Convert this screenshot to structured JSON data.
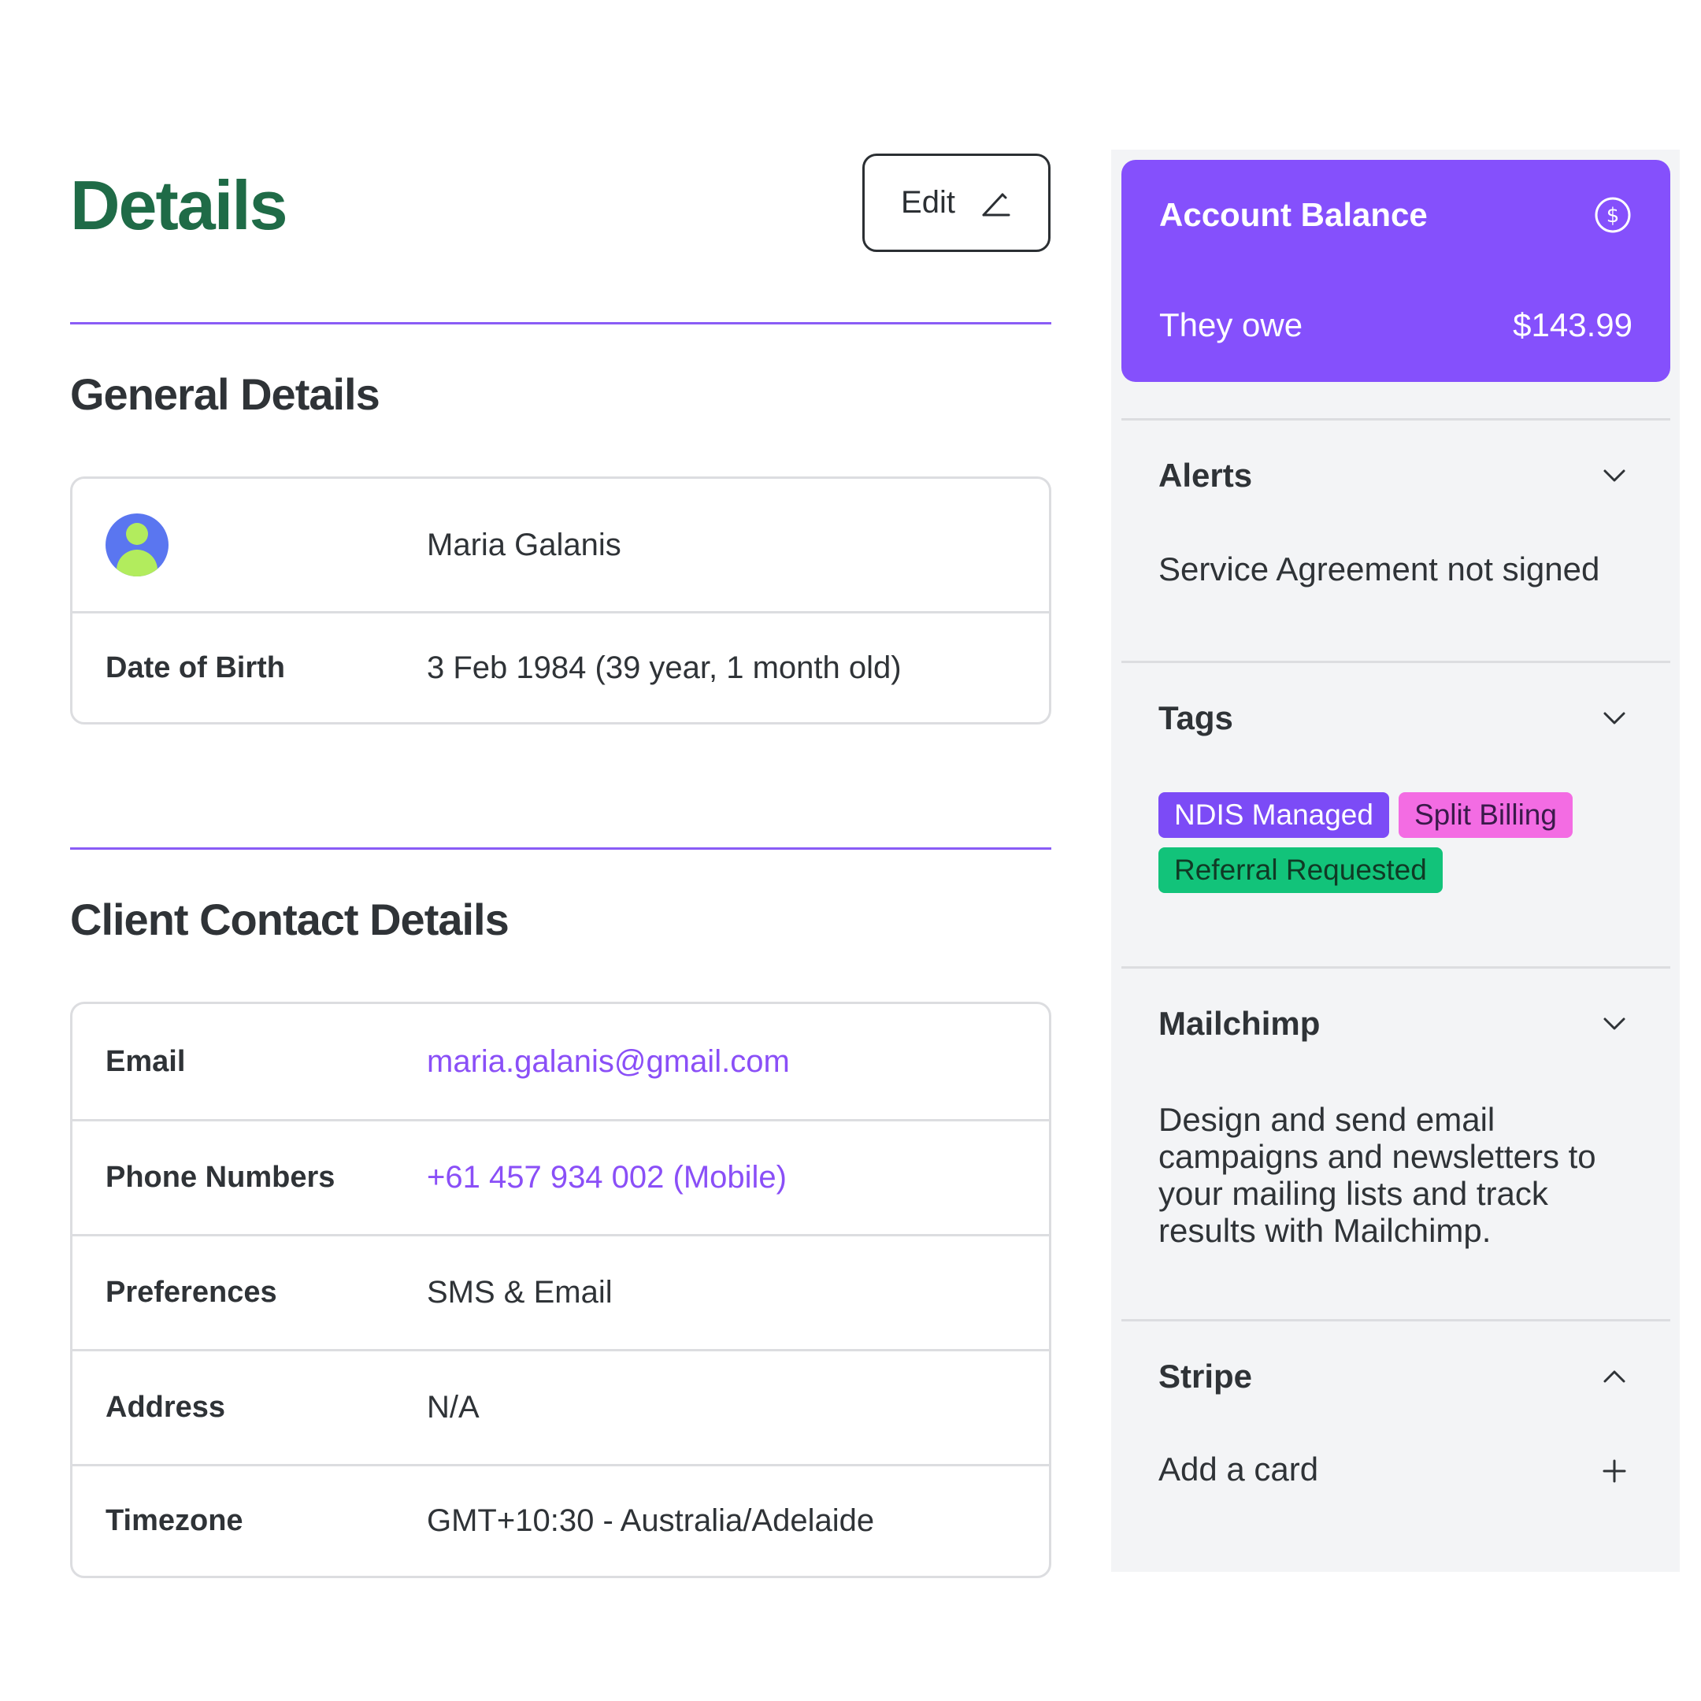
{
  "header": {
    "title": "Details",
    "edit_label": "Edit"
  },
  "general": {
    "section_title": "General Details",
    "name": "Maria Galanis",
    "dob_label": "Date of Birth",
    "dob_value": "3 Feb 1984 (39 year, 1 month old)"
  },
  "contact": {
    "section_title": "Client Contact Details",
    "rows": [
      {
        "label": "Email",
        "value": "maria.galanis@gmail.com"
      },
      {
        "label": "Phone Numbers",
        "value": "+61 457 934 002 (Mobile)"
      },
      {
        "label": "Preferences",
        "value": "SMS & Email"
      },
      {
        "label": "Address",
        "value": "N/A"
      },
      {
        "label": "Timezone",
        "value": "GMT+10:30 - Australia/Adelaide"
      }
    ]
  },
  "balance": {
    "title": "Account Balance",
    "label": "They owe",
    "amount": "$143.99",
    "icon": "dollar-circle-icon"
  },
  "alerts": {
    "title": "Alerts",
    "text": "Service Agreement not signed"
  },
  "tags": {
    "title": "Tags",
    "items": [
      "NDIS Managed",
      "Split Billing",
      "Referral Requested"
    ]
  },
  "mailchimp": {
    "title": "Mailchimp",
    "description": "Design and send email campaigns and newsletters to your mailing lists and track results with Mailchimp."
  },
  "stripe": {
    "title": "Stripe",
    "add_card_label": "Add a card"
  },
  "colors": {
    "brand_green": "#1f6b47",
    "accent_purple": "#8550fc",
    "link_purple": "#8a4ff7",
    "tag_ndis": "#7c4bf6",
    "tag_split": "#f36ce3",
    "tag_referral": "#12c37a"
  }
}
